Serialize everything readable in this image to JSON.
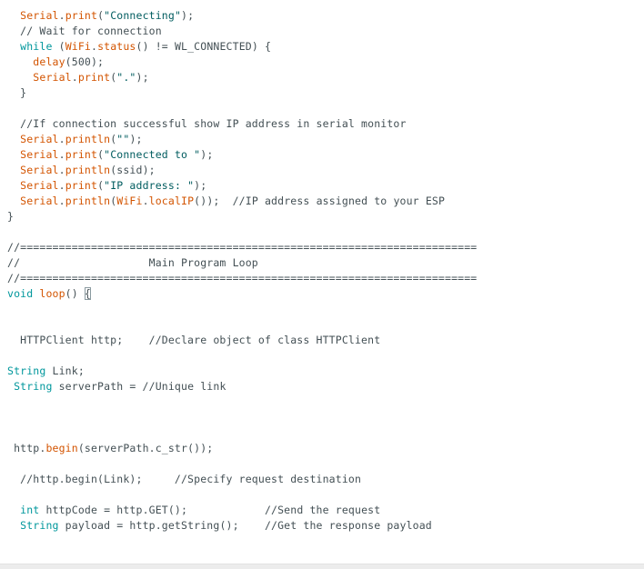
{
  "editor": {
    "lines": [
      [
        {
          "t": "  ",
          "s": "plain"
        },
        {
          "t": "Serial",
          "s": "fn"
        },
        {
          "t": ".",
          "s": "plain"
        },
        {
          "t": "print",
          "s": "fn"
        },
        {
          "t": "(",
          "s": "plain"
        },
        {
          "t": "\"Connecting\"",
          "s": "str"
        },
        {
          "t": ");",
          "s": "plain"
        }
      ],
      [
        {
          "t": "  // Wait for connection",
          "s": "comment"
        }
      ],
      [
        {
          "t": "  ",
          "s": "plain"
        },
        {
          "t": "while",
          "s": "kw"
        },
        {
          "t": " (",
          "s": "plain"
        },
        {
          "t": "WiFi",
          "s": "fn"
        },
        {
          "t": ".",
          "s": "plain"
        },
        {
          "t": "status",
          "s": "fn"
        },
        {
          "t": "() != WL_CONNECTED) {",
          "s": "plain"
        }
      ],
      [
        {
          "t": "    ",
          "s": "plain"
        },
        {
          "t": "delay",
          "s": "fn"
        },
        {
          "t": "(500);",
          "s": "plain"
        }
      ],
      [
        {
          "t": "    ",
          "s": "plain"
        },
        {
          "t": "Serial",
          "s": "fn"
        },
        {
          "t": ".",
          "s": "plain"
        },
        {
          "t": "print",
          "s": "fn"
        },
        {
          "t": "(",
          "s": "plain"
        },
        {
          "t": "\".\"",
          "s": "str"
        },
        {
          "t": ");",
          "s": "plain"
        }
      ],
      [
        {
          "t": "  }",
          "s": "plain"
        }
      ],
      [],
      [
        {
          "t": "  //If connection successful show IP address in serial monitor",
          "s": "comment"
        }
      ],
      [
        {
          "t": "  ",
          "s": "plain"
        },
        {
          "t": "Serial",
          "s": "fn"
        },
        {
          "t": ".",
          "s": "plain"
        },
        {
          "t": "println",
          "s": "fn"
        },
        {
          "t": "(",
          "s": "plain"
        },
        {
          "t": "\"\"",
          "s": "str"
        },
        {
          "t": ");",
          "s": "plain"
        }
      ],
      [
        {
          "t": "  ",
          "s": "plain"
        },
        {
          "t": "Serial",
          "s": "fn"
        },
        {
          "t": ".",
          "s": "plain"
        },
        {
          "t": "print",
          "s": "fn"
        },
        {
          "t": "(",
          "s": "plain"
        },
        {
          "t": "\"Connected to \"",
          "s": "str"
        },
        {
          "t": ");",
          "s": "plain"
        }
      ],
      [
        {
          "t": "  ",
          "s": "plain"
        },
        {
          "t": "Serial",
          "s": "fn"
        },
        {
          "t": ".",
          "s": "plain"
        },
        {
          "t": "println",
          "s": "fn"
        },
        {
          "t": "(ssid);",
          "s": "plain"
        }
      ],
      [
        {
          "t": "  ",
          "s": "plain"
        },
        {
          "t": "Serial",
          "s": "fn"
        },
        {
          "t": ".",
          "s": "plain"
        },
        {
          "t": "print",
          "s": "fn"
        },
        {
          "t": "(",
          "s": "plain"
        },
        {
          "t": "\"IP address: \"",
          "s": "str"
        },
        {
          "t": ");",
          "s": "plain"
        }
      ],
      [
        {
          "t": "  ",
          "s": "plain"
        },
        {
          "t": "Serial",
          "s": "fn"
        },
        {
          "t": ".",
          "s": "plain"
        },
        {
          "t": "println",
          "s": "fn"
        },
        {
          "t": "(",
          "s": "plain"
        },
        {
          "t": "WiFi",
          "s": "fn"
        },
        {
          "t": ".",
          "s": "plain"
        },
        {
          "t": "localIP",
          "s": "fn"
        },
        {
          "t": "());  //IP address assigned to your ESP",
          "s": "plain"
        }
      ],
      [
        {
          "t": "}",
          "s": "plain"
        }
      ],
      [],
      [
        {
          "t": "//=======================================================================",
          "s": "comment"
        }
      ],
      [
        {
          "t": "//                    Main Program Loop",
          "s": "comment"
        }
      ],
      [
        {
          "t": "//=======================================================================",
          "s": "comment"
        }
      ],
      [
        {
          "t": "void",
          "s": "kw"
        },
        {
          "t": " ",
          "s": "plain"
        },
        {
          "t": "loop",
          "s": "fn"
        },
        {
          "t": "() ",
          "s": "plain"
        },
        {
          "t": "{",
          "s": "bracket"
        }
      ],
      [],
      [],
      [
        {
          "t": "  HTTPClient http;    //Declare object of class HTTPClient",
          "s": "plain"
        }
      ],
      [],
      [
        {
          "t": "String",
          "s": "kw"
        },
        {
          "t": " Link;",
          "s": "plain"
        }
      ],
      [
        {
          "t": " ",
          "s": "plain"
        },
        {
          "t": "String",
          "s": "kw"
        },
        {
          "t": " serverPath = //Unique link",
          "s": "plain"
        }
      ],
      [],
      [],
      [],
      [
        {
          "t": " http.",
          "s": "plain"
        },
        {
          "t": "begin",
          "s": "fn"
        },
        {
          "t": "(serverPath.c_str());",
          "s": "plain"
        }
      ],
      [],
      [
        {
          "t": "  //http.begin(Link);     //Specify request destination",
          "s": "comment"
        }
      ],
      [],
      [
        {
          "t": "  ",
          "s": "plain"
        },
        {
          "t": "int",
          "s": "kw"
        },
        {
          "t": " httpCode = http.GET();            //Send the request",
          "s": "plain"
        }
      ],
      [
        {
          "t": "  ",
          "s": "plain"
        },
        {
          "t": "String",
          "s": "kw"
        },
        {
          "t": " payload = http.getString();    //Get the response payload",
          "s": "plain"
        }
      ]
    ]
  }
}
